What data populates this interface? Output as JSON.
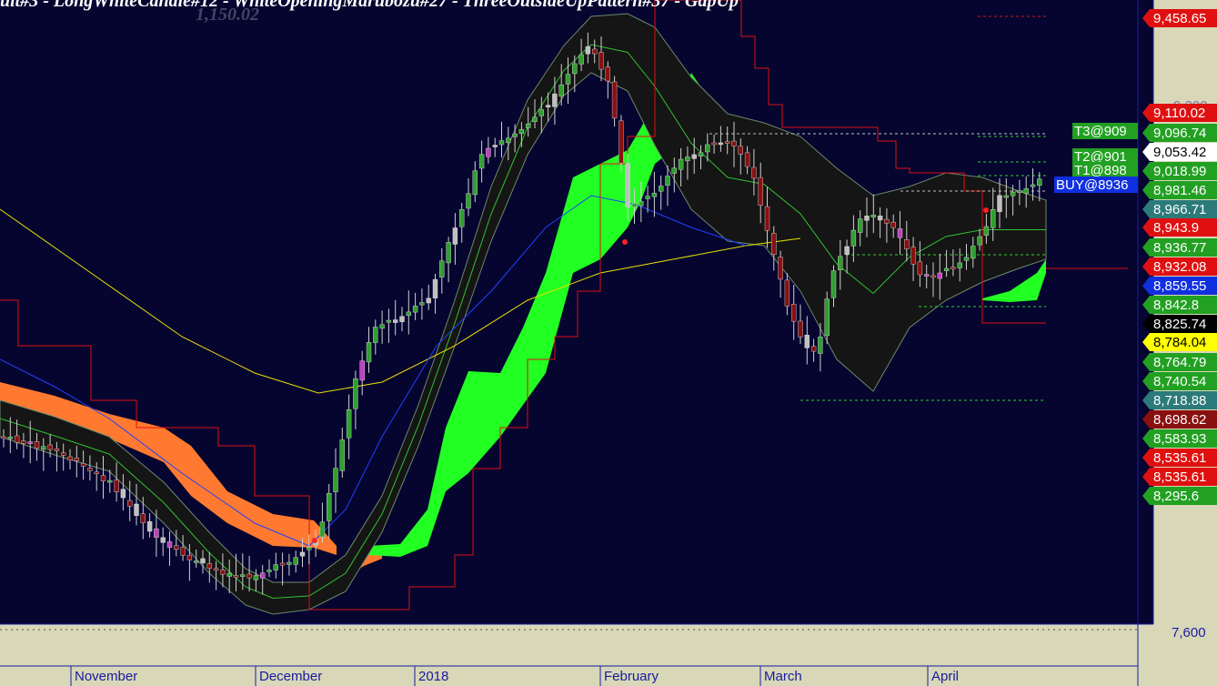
{
  "header": {
    "pattern_text": "ult#3 - LongWhiteCandle#12 - WhiteOpeningMarubozu#27 - ThreeOutsideUpPattern#37 - GapUp",
    "overlay_text": "1,150.02"
  },
  "chart_data": {
    "type": "candlestick",
    "x_months": [
      "November",
      "December",
      "2018",
      "February",
      "March",
      "April"
    ],
    "y_ticks": [
      "9,200",
      "7,600"
    ],
    "ylim": [
      7600,
      9500
    ],
    "price_tags": [
      {
        "label": "9,458.65",
        "value": 9458.65,
        "bg": "#e01010",
        "fg": "#ffffff"
      },
      {
        "label": "9,110.02",
        "value": 9110.02,
        "bg": "#e01010",
        "fg": "#ffffff"
      },
      {
        "label": "9,096.74",
        "value": 9096.74,
        "bg": "#22a022",
        "fg": "#ffffff"
      },
      {
        "label": "9,053.42",
        "value": 9053.42,
        "bg": "#ffffff",
        "fg": "#000000"
      },
      {
        "label": "9,018.99",
        "value": 9018.99,
        "bg": "#22a022",
        "fg": "#ffffff"
      },
      {
        "label": "8,981.46",
        "value": 8981.46,
        "bg": "#22a022",
        "fg": "#ffffff"
      },
      {
        "label": "8,966.71",
        "value": 8966.71,
        "bg": "#2c7a7a",
        "fg": "#ffffff"
      },
      {
        "label": "8,943.9",
        "value": 8943.9,
        "bg": "#e01010",
        "fg": "#ffffff"
      },
      {
        "label": "8,936.77",
        "value": 8936.77,
        "bg": "#22a022",
        "fg": "#ffffff"
      },
      {
        "label": "8,932.08",
        "value": 8932.08,
        "bg": "#e01010",
        "fg": "#ffffff"
      },
      {
        "label": "8,859.55",
        "value": 8859.55,
        "bg": "#1030e0",
        "fg": "#ffffff"
      },
      {
        "label": "8,842.8",
        "value": 8842.8,
        "bg": "#22a022",
        "fg": "#ffffff"
      },
      {
        "label": "8,825.74",
        "value": 8825.74,
        "bg": "#000000",
        "fg": "#ffffff"
      },
      {
        "label": "8,784.04",
        "value": 8784.04,
        "bg": "#ffff00",
        "fg": "#000000"
      },
      {
        "label": "8,764.79",
        "value": 8764.79,
        "bg": "#22a022",
        "fg": "#ffffff"
      },
      {
        "label": "8,740.54",
        "value": 8740.54,
        "bg": "#22a022",
        "fg": "#ffffff"
      },
      {
        "label": "8,718.88",
        "value": 8718.88,
        "bg": "#2c7a7a",
        "fg": "#ffffff"
      },
      {
        "label": "8,698.62",
        "value": 8698.62,
        "bg": "#8a1010",
        "fg": "#ffffff"
      },
      {
        "label": "8,583.93",
        "value": 8583.93,
        "bg": "#22a022",
        "fg": "#ffffff"
      },
      {
        "label": "8,535.61",
        "value": 8535.61,
        "bg": "#e01010",
        "fg": "#ffffff"
      },
      {
        "label": "8,535.61",
        "value": 8535.61,
        "bg": "#e01010",
        "fg": "#ffffff"
      },
      {
        "label": "8,295.6",
        "value": 8295.6,
        "bg": "#22a022",
        "fg": "#ffffff"
      }
    ],
    "trade_tags": [
      {
        "label": "T3@909",
        "bg": "#22a022"
      },
      {
        "label": "T2@901",
        "bg": "#22a022"
      },
      {
        "label": "T1@898",
        "bg": "#22a022"
      },
      {
        "label": "BUY@8936",
        "bg": "#1030e0"
      }
    ],
    "colors": {
      "plot_bg": "#050530",
      "axis_bg": "#d8d8b8",
      "bull_candle": "#2fa02f",
      "bear_candle": "#8a1010",
      "doji_candle": "#c0c0c0",
      "magenta_candle": "#c040c0",
      "cloud_green": "#22ff22",
      "cloud_orange": "#ff7a30",
      "band_fill": "#151515",
      "ma_yellow": "#e8e000",
      "ma_blue": "#2040ff",
      "ma_red": "#e01010",
      "ma_green": "#30c030"
    }
  }
}
